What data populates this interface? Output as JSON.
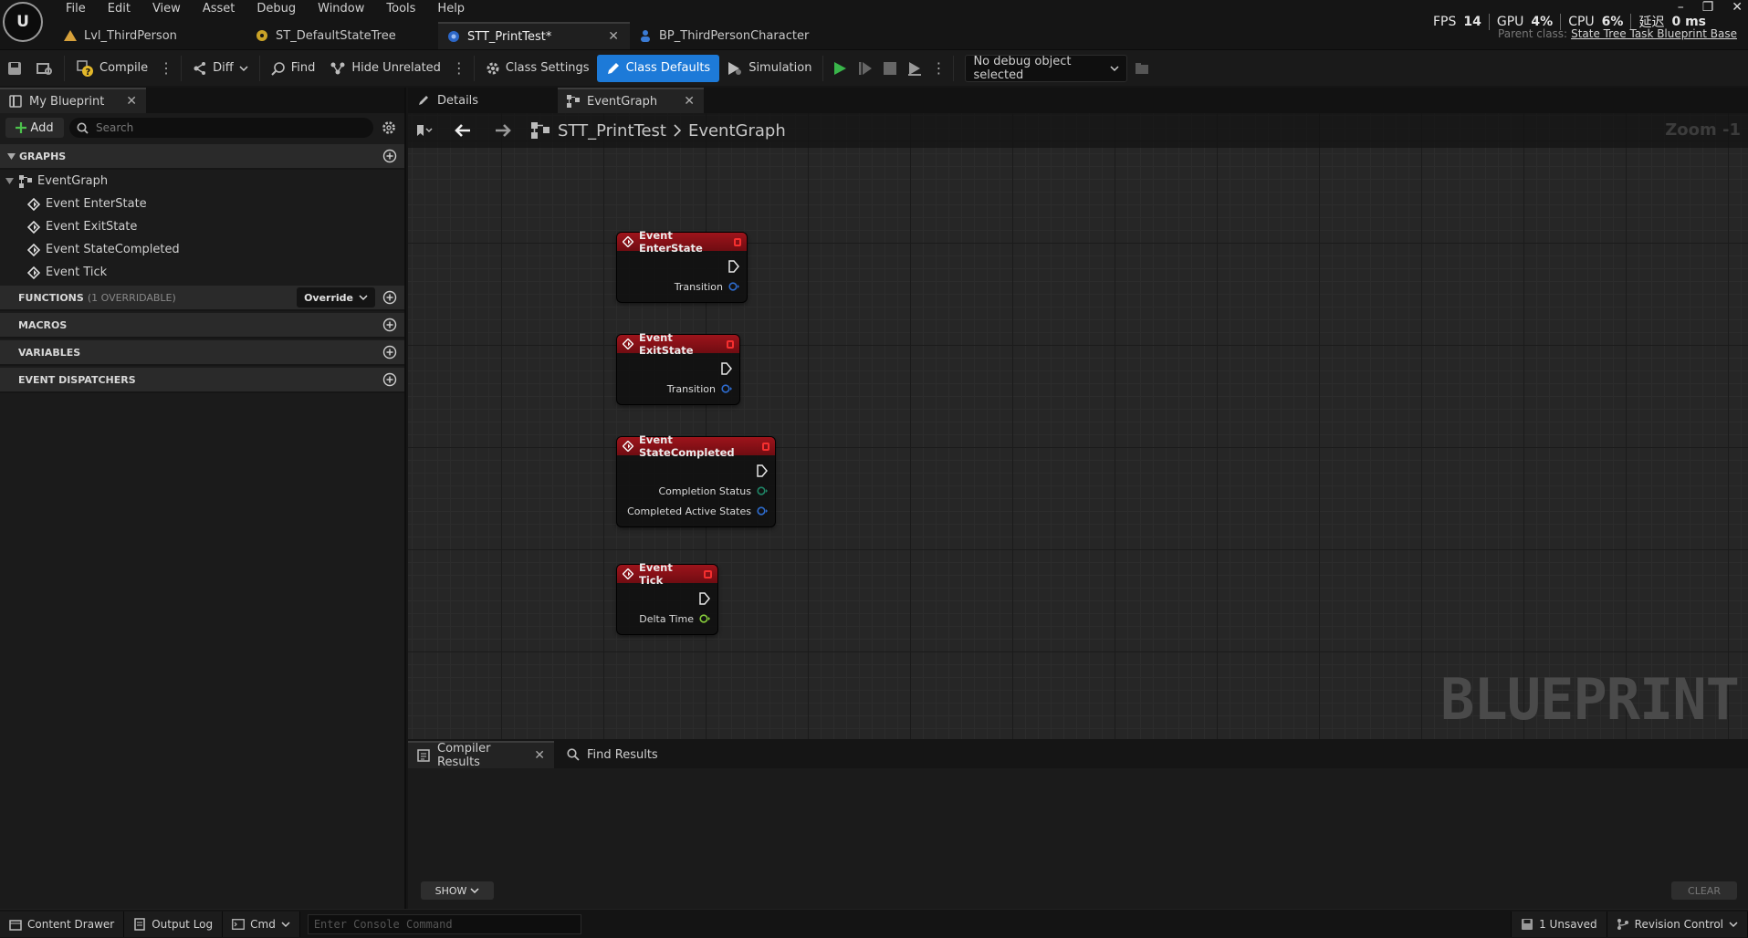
{
  "app": {
    "logo_text": "U",
    "menus": [
      "File",
      "Edit",
      "View",
      "Asset",
      "Debug",
      "Window",
      "Tools",
      "Help"
    ],
    "tabs": [
      {
        "label": "Lvl_ThirdPerson",
        "icon": "level-icon",
        "active": false
      },
      {
        "label": "ST_DefaultStateTree",
        "icon": "state-tree-icon",
        "active": false
      },
      {
        "label": "STT_PrintTest*",
        "icon": "blueprint-icon",
        "active": true
      },
      {
        "label": "BP_ThirdPersonCharacter",
        "icon": "character-icon",
        "active": false
      }
    ],
    "stats": {
      "fps_label": "FPS",
      "fps": "14",
      "gpu_label": "GPU",
      "gpu": "4%",
      "cpu_label": "CPU",
      "cpu": "6%",
      "latency_label": "延迟",
      "latency": "0 ms"
    },
    "parent_class_label": "Parent class:",
    "parent_class": "State Tree Task Blueprint Base",
    "window_controls": {
      "minimize": "–",
      "restore": "❐",
      "close": "✕"
    }
  },
  "toolbar": {
    "compile": "Compile",
    "diff": "Diff",
    "find": "Find",
    "hide_unrelated": "Hide Unrelated",
    "class_settings": "Class Settings",
    "class_defaults": "Class Defaults",
    "simulation": "Simulation",
    "debug_object": "No debug object selected"
  },
  "my_blueprint": {
    "tab_label": "My Blueprint",
    "add_label": "Add",
    "search_placeholder": "Search",
    "graphs_label": "GRAPHS",
    "event_graph": "EventGraph",
    "events": [
      "Event EnterState",
      "Event ExitState",
      "Event StateCompleted",
      "Event Tick"
    ],
    "functions_label": "FUNCTIONS",
    "functions_meta": "(1 OVERRIDABLE)",
    "override_label": "Override",
    "macros_label": "MACROS",
    "variables_label": "VARIABLES",
    "dispatchers_label": "EVENT DISPATCHERS"
  },
  "graph": {
    "details_tab": "Details",
    "graph_tab": "EventGraph",
    "breadcrumb_root": "STT_PrintTest",
    "breadcrumb_leaf": "EventGraph",
    "zoom": "Zoom -1",
    "watermark": "BLUEPRINT",
    "nodes": [
      {
        "title": "Event EnterState",
        "pins": [
          {
            "label": "Transition",
            "color": "#2f6fd6"
          }
        ]
      },
      {
        "title": "Event ExitState",
        "pins": [
          {
            "label": "Transition",
            "color": "#2f6fd6"
          }
        ]
      },
      {
        "title": "Event StateCompleted",
        "pins": [
          {
            "label": "Completion Status",
            "color": "#1f8a6a"
          },
          {
            "label": "Completed Active States",
            "color": "#2f6fd6"
          }
        ]
      },
      {
        "title": "Event Tick",
        "pins": [
          {
            "label": "Delta Time",
            "color": "#8bd43c"
          }
        ]
      }
    ]
  },
  "bottom": {
    "compiler_results": "Compiler Results",
    "find_results": "Find Results",
    "show": "SHOW",
    "clear": "CLEAR"
  },
  "status": {
    "content_drawer": "Content Drawer",
    "output_log": "Output Log",
    "cmd": "Cmd",
    "console_placeholder": "Enter Console Command",
    "unsaved": "1 Unsaved",
    "revision_control": "Revision Control"
  }
}
